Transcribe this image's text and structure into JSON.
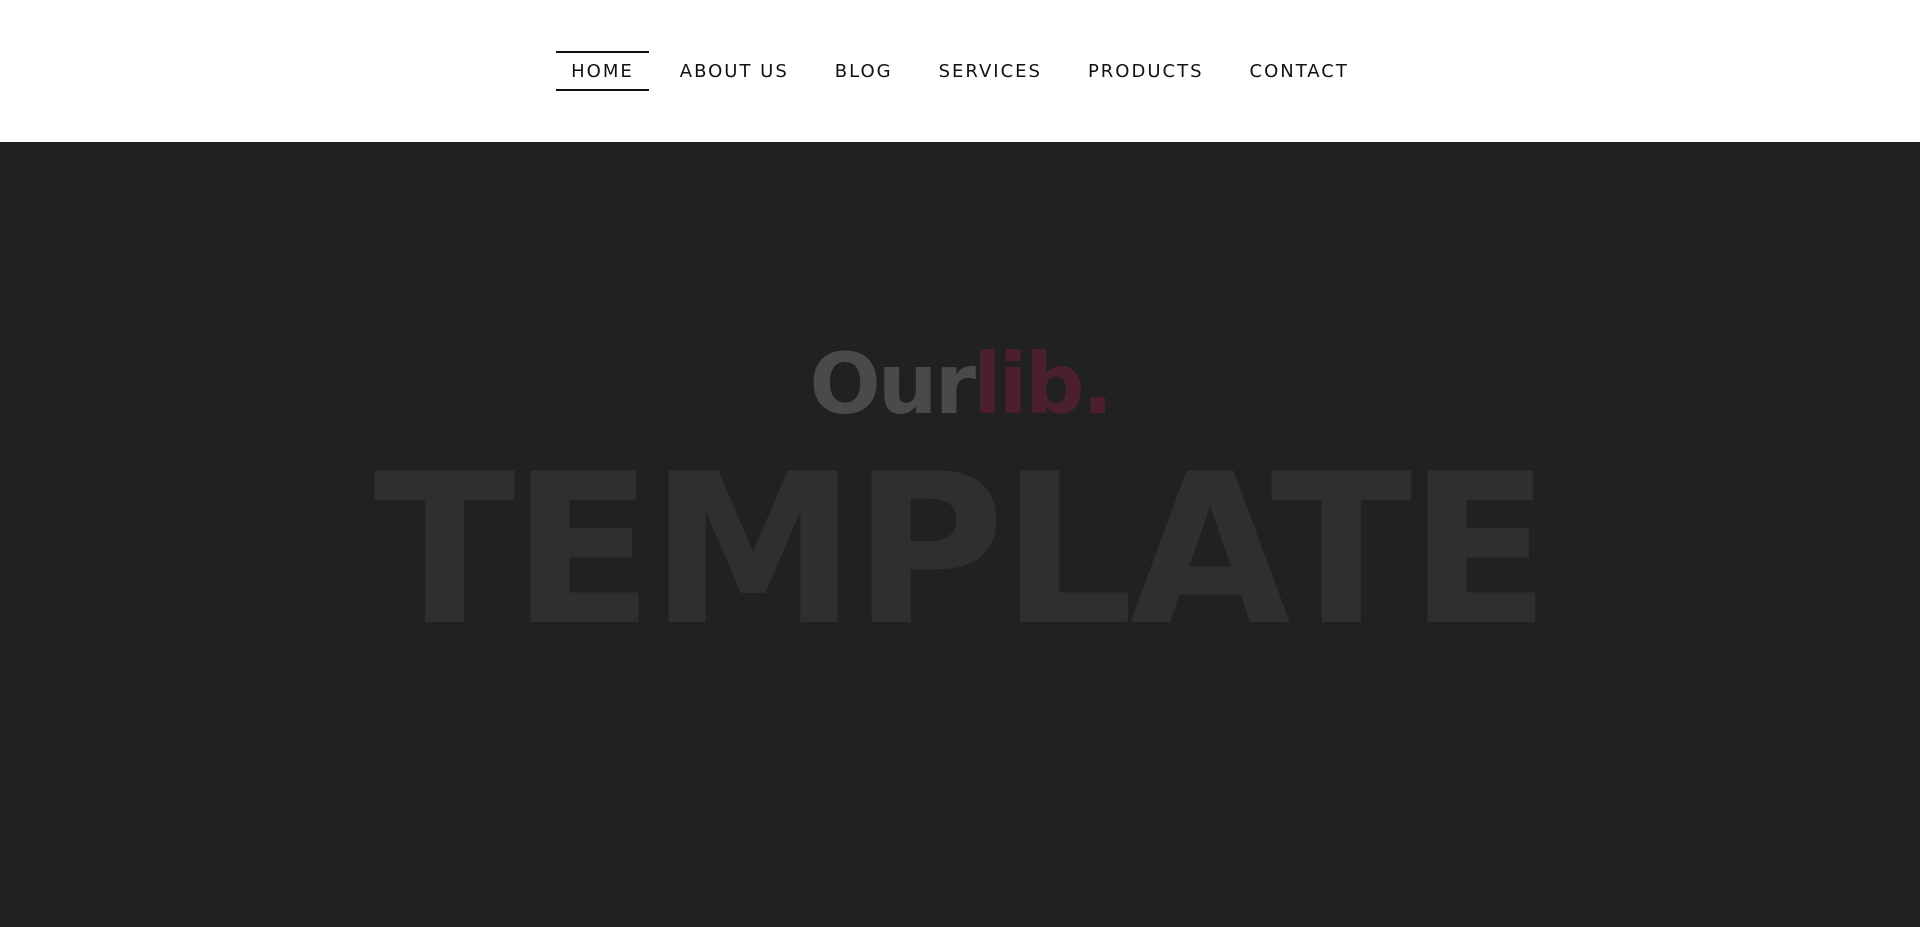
{
  "nav": {
    "items": [
      {
        "label": "HOME",
        "active": true
      },
      {
        "label": "ABOUT US",
        "active": false
      },
      {
        "label": "BLOG",
        "active": false
      },
      {
        "label": "SERVICES",
        "active": false
      },
      {
        "label": "PRODUCTS",
        "active": false
      },
      {
        "label": "CONTACT",
        "active": false
      }
    ]
  },
  "hero": {
    "brand_part1": "Our",
    "brand_part2": "lib.",
    "big_word": "TEMPLATE"
  },
  "colors": {
    "hero_background": "#212121",
    "brand_part1": "#4a4a4a",
    "brand_part2": "#4b1f2b",
    "big_word": "#2f2f2f"
  }
}
